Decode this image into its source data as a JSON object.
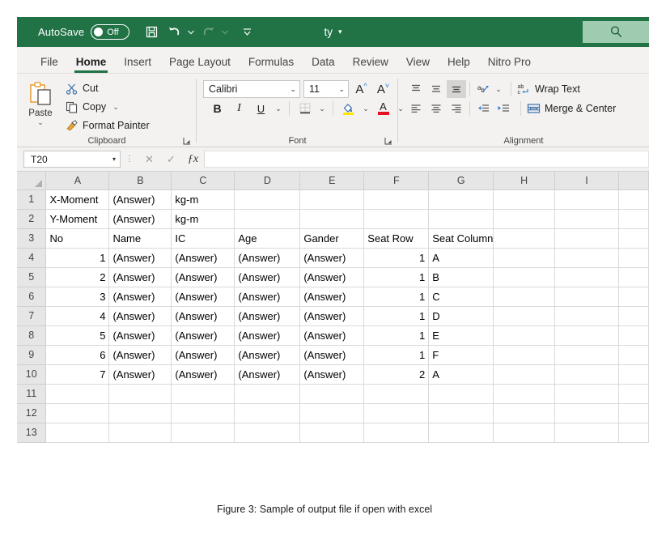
{
  "titlebar": {
    "autosave_label": "AutoSave",
    "autosave_state": "Off",
    "save_icon": "save-icon",
    "undo_icon": "undo-icon",
    "redo_icon": "redo-icon",
    "customize_icon": "customize-quick-access-icon",
    "document_title": "ty",
    "title_caret": "▾",
    "search_icon": "search-icon",
    "bg_color": "#217346",
    "search_bg_color": "#9fcbb0"
  },
  "tabs": [
    {
      "label": "File",
      "active": false
    },
    {
      "label": "Home",
      "active": true
    },
    {
      "label": "Insert",
      "active": false
    },
    {
      "label": "Page Layout",
      "active": false
    },
    {
      "label": "Formulas",
      "active": false
    },
    {
      "label": "Data",
      "active": false
    },
    {
      "label": "Review",
      "active": false
    },
    {
      "label": "View",
      "active": false
    },
    {
      "label": "Help",
      "active": false
    },
    {
      "label": "Nitro Pro",
      "active": false
    }
  ],
  "ribbon": {
    "clipboard": {
      "group_label": "Clipboard",
      "paste_label": "Paste",
      "paste_caret": "⌄",
      "cut_label": "Cut",
      "copy_label": "Copy",
      "copy_caret": "⌄",
      "format_painter_label": "Format Painter",
      "dialog_launcher": "dialog-box-launcher"
    },
    "font": {
      "group_label": "Font",
      "font_name": "Calibri",
      "font_size": "11",
      "caret": "⌄",
      "grow_font": "A",
      "shrink_font": "A",
      "bold": "B",
      "italic": "I",
      "underline": "U",
      "borders": "borders-icon",
      "fill_color": "fill-color-icon",
      "font_color": "A",
      "dialog_launcher": "dialog-box-launcher"
    },
    "alignment": {
      "group_label": "Alignment",
      "align_top": "align-top-icon",
      "align_middle": "align-middle-icon",
      "align_bottom": "align-bottom-icon",
      "orientation": "orientation-icon",
      "align_left": "align-left-icon",
      "align_center": "align-center-icon",
      "align_right": "align-right-icon",
      "decrease_indent": "decrease-indent-icon",
      "increase_indent": "increase-indent-icon",
      "wrap_text_label": "Wrap Text",
      "merge_center_label": "Merge & Center",
      "dialog_launcher": "dialog-box-launcher"
    }
  },
  "formula_bar": {
    "name_box_value": "T20",
    "name_box_caret": "▾",
    "cancel_icon": "✕",
    "enter_icon": "✓",
    "function_icon": "ƒx",
    "formula_value": ""
  },
  "grid": {
    "column_headers": [
      "A",
      "B",
      "C",
      "D",
      "E",
      "F",
      "G",
      "H",
      "I"
    ],
    "row_headers": [
      "1",
      "2",
      "3",
      "4",
      "5",
      "6",
      "7",
      "8",
      "9",
      "10",
      "11",
      "12",
      "13"
    ],
    "rows": [
      {
        "num": "1",
        "cells": [
          {
            "v": "X-Moment",
            "align": "l",
            "clip": true
          },
          {
            "v": "(Answer)",
            "align": "l"
          },
          {
            "v": "kg-m",
            "align": "l"
          },
          {
            "v": "",
            "align": "l"
          },
          {
            "v": "",
            "align": "l"
          },
          {
            "v": "",
            "align": "l"
          },
          {
            "v": "",
            "align": "l"
          },
          {
            "v": "",
            "align": "l"
          },
          {
            "v": "",
            "align": "l"
          }
        ]
      },
      {
        "num": "2",
        "cells": [
          {
            "v": "Y-Moment",
            "align": "l",
            "clip": true
          },
          {
            "v": "(Answer)",
            "align": "l"
          },
          {
            "v": "kg-m",
            "align": "l"
          },
          {
            "v": "",
            "align": "l"
          },
          {
            "v": "",
            "align": "l"
          },
          {
            "v": "",
            "align": "l"
          },
          {
            "v": "",
            "align": "l"
          },
          {
            "v": "",
            "align": "l"
          },
          {
            "v": "",
            "align": "l"
          }
        ]
      },
      {
        "num": "3",
        "cells": [
          {
            "v": "No",
            "align": "l"
          },
          {
            "v": "Name",
            "align": "l"
          },
          {
            "v": "IC",
            "align": "l"
          },
          {
            "v": "Age",
            "align": "l"
          },
          {
            "v": "Gander",
            "align": "l"
          },
          {
            "v": "Seat Row",
            "align": "l"
          },
          {
            "v": "Seat Column",
            "align": "l",
            "overflow": true
          },
          {
            "v": "",
            "align": "l"
          },
          {
            "v": "",
            "align": "l"
          }
        ]
      },
      {
        "num": "4",
        "cells": [
          {
            "v": "1",
            "align": "r"
          },
          {
            "v": "(Answer)",
            "align": "l"
          },
          {
            "v": "(Answer)",
            "align": "l"
          },
          {
            "v": "(Answer)",
            "align": "l"
          },
          {
            "v": "(Answer)",
            "align": "l"
          },
          {
            "v": "1",
            "align": "r"
          },
          {
            "v": "A",
            "align": "l"
          },
          {
            "v": "",
            "align": "l"
          },
          {
            "v": "",
            "align": "l"
          }
        ]
      },
      {
        "num": "5",
        "cells": [
          {
            "v": "2",
            "align": "r"
          },
          {
            "v": "(Answer)",
            "align": "l"
          },
          {
            "v": "(Answer)",
            "align": "l"
          },
          {
            "v": "(Answer)",
            "align": "l"
          },
          {
            "v": "(Answer)",
            "align": "l"
          },
          {
            "v": "1",
            "align": "r"
          },
          {
            "v": "B",
            "align": "l"
          },
          {
            "v": "",
            "align": "l"
          },
          {
            "v": "",
            "align": "l"
          }
        ]
      },
      {
        "num": "6",
        "cells": [
          {
            "v": "3",
            "align": "r"
          },
          {
            "v": "(Answer)",
            "align": "l"
          },
          {
            "v": "(Answer)",
            "align": "l"
          },
          {
            "v": "(Answer)",
            "align": "l"
          },
          {
            "v": "(Answer)",
            "align": "l"
          },
          {
            "v": "1",
            "align": "r"
          },
          {
            "v": "C",
            "align": "l"
          },
          {
            "v": "",
            "align": "l"
          },
          {
            "v": "",
            "align": "l"
          }
        ]
      },
      {
        "num": "7",
        "cells": [
          {
            "v": "4",
            "align": "r"
          },
          {
            "v": "(Answer)",
            "align": "l"
          },
          {
            "v": "(Answer)",
            "align": "l"
          },
          {
            "v": "(Answer)",
            "align": "l"
          },
          {
            "v": "(Answer)",
            "align": "l"
          },
          {
            "v": "1",
            "align": "r"
          },
          {
            "v": "D",
            "align": "l"
          },
          {
            "v": "",
            "align": "l"
          },
          {
            "v": "",
            "align": "l"
          }
        ]
      },
      {
        "num": "8",
        "cells": [
          {
            "v": "5",
            "align": "r"
          },
          {
            "v": "(Answer)",
            "align": "l"
          },
          {
            "v": "(Answer)",
            "align": "l"
          },
          {
            "v": "(Answer)",
            "align": "l"
          },
          {
            "v": "(Answer)",
            "align": "l"
          },
          {
            "v": "1",
            "align": "r"
          },
          {
            "v": "E",
            "align": "l"
          },
          {
            "v": "",
            "align": "l"
          },
          {
            "v": "",
            "align": "l"
          }
        ]
      },
      {
        "num": "9",
        "cells": [
          {
            "v": "6",
            "align": "r"
          },
          {
            "v": "(Answer)",
            "align": "l"
          },
          {
            "v": "(Answer)",
            "align": "l"
          },
          {
            "v": "(Answer)",
            "align": "l"
          },
          {
            "v": "(Answer)",
            "align": "l"
          },
          {
            "v": "1",
            "align": "r"
          },
          {
            "v": "F",
            "align": "l"
          },
          {
            "v": "",
            "align": "l"
          },
          {
            "v": "",
            "align": "l"
          }
        ]
      },
      {
        "num": "10",
        "cells": [
          {
            "v": "7",
            "align": "r"
          },
          {
            "v": "(Answer)",
            "align": "l"
          },
          {
            "v": "(Answer)",
            "align": "l"
          },
          {
            "v": "(Answer)",
            "align": "l"
          },
          {
            "v": "(Answer)",
            "align": "l"
          },
          {
            "v": "2",
            "align": "r"
          },
          {
            "v": "A",
            "align": "l"
          },
          {
            "v": "",
            "align": "l"
          },
          {
            "v": "",
            "align": "l"
          }
        ]
      },
      {
        "num": "11",
        "cells": [
          {
            "v": "",
            "align": "l"
          },
          {
            "v": "",
            "align": "l"
          },
          {
            "v": "",
            "align": "l"
          },
          {
            "v": "",
            "align": "l"
          },
          {
            "v": "",
            "align": "l"
          },
          {
            "v": "",
            "align": "l"
          },
          {
            "v": "",
            "align": "l"
          },
          {
            "v": "",
            "align": "l"
          },
          {
            "v": "",
            "align": "l"
          }
        ]
      },
      {
        "num": "12",
        "cells": [
          {
            "v": "",
            "align": "l"
          },
          {
            "v": "",
            "align": "l"
          },
          {
            "v": "",
            "align": "l"
          },
          {
            "v": "",
            "align": "l"
          },
          {
            "v": "",
            "align": "l"
          },
          {
            "v": "",
            "align": "l"
          },
          {
            "v": "",
            "align": "l"
          },
          {
            "v": "",
            "align": "l"
          },
          {
            "v": "",
            "align": "l"
          }
        ]
      },
      {
        "num": "13",
        "cells": [
          {
            "v": "",
            "align": "l"
          },
          {
            "v": "",
            "align": "l"
          },
          {
            "v": "",
            "align": "l"
          },
          {
            "v": "",
            "align": "l"
          },
          {
            "v": "",
            "align": "l"
          },
          {
            "v": "",
            "align": "l"
          },
          {
            "v": "",
            "align": "l"
          },
          {
            "v": "",
            "align": "l"
          },
          {
            "v": "",
            "align": "l"
          }
        ]
      }
    ]
  },
  "caption": "Figure 3: Sample of output file if open with excel"
}
